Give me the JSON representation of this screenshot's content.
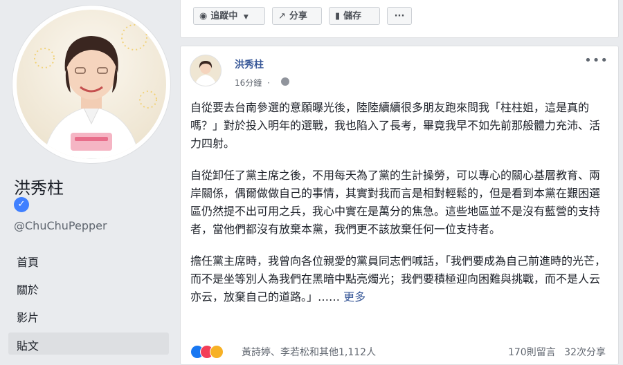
{
  "page": {
    "name": "洪秀柱",
    "handle": "@ChuChuPepper",
    "verified_icon": "check-icon"
  },
  "nav": {
    "items": [
      {
        "label": "首頁"
      },
      {
        "label": "關於"
      },
      {
        "label": "影片"
      },
      {
        "label": "貼文",
        "active": true
      }
    ]
  },
  "actions": {
    "follow_label": "追蹤中",
    "share_label": "分享",
    "save_label": "儲存",
    "more_label": "···"
  },
  "post": {
    "author": "洪秀柱",
    "time": "16分鐘",
    "time_separator": "·",
    "paragraphs": [
      "自從要去台南參選的意願曝光後，陸陸續續很多朋友跑來問我「柱柱姐，這是真的嗎？」對於投入明年的選戰，我也陷入了長考，畢竟我早不如先前那般體力充沛、活力四射。",
      "自從卸任了黨主席之後，不用每天為了黨的生計操勞，可以專心的關心基層教育、兩岸關係，偶爾做做自己的事情，其實對我而言是相對輕鬆的，但是看到本黨在艱困選區仍然提不出可用之兵，我心中實在是萬分的焦急。這些地區並不是沒有藍營的支持者，當他們都沒有放棄本黨，我們更不該放棄任何一位支持者。",
      "擔任黨主席時，我曾向各位親愛的黨員同志們喊話，「我們要成為自己前進時的光芒，而不是坐等別人為我們在黑暗中點亮燭光；我們要積極迎向困難與挑戰，而不是人云亦云，放棄自己的道路。」……"
    ],
    "see_more": "更多",
    "reactors": "黃詩婷、李若松和其他1,112人",
    "comments": "170則留言",
    "shares": "32次分享",
    "menu_icon": "more-horizontal-icon"
  },
  "colors": {
    "link": "#385898",
    "page_bg": "#e9ebee",
    "like": "#1877f2",
    "love": "#f33e58",
    "wow": "#f7b125"
  }
}
